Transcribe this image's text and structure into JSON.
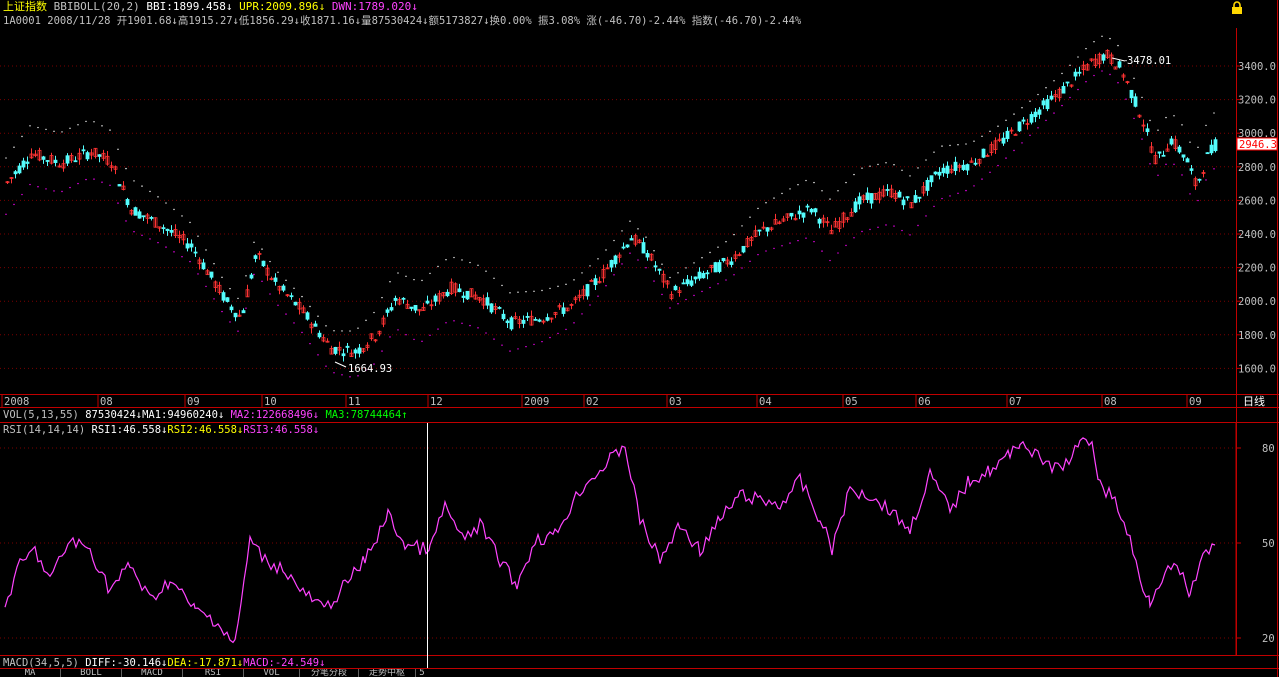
{
  "header": {
    "index_name": "上证指数",
    "indicator": "BBIBOLL(20,2)",
    "bbi": "BBI:1899.458",
    "upr": "UPR:2009.896",
    "dwn": "DWN:1789.020",
    "arrow": "↓",
    "arrow_up": "↑",
    "ohlc_line": "1A0001 2008/11/28 开1901.68↓高1915.27↓低1856.29↓收1871.16↓量87530424↓额5173827↓换0.00% 振3.08% 涨(-46.70)-2.44% 指数(-46.70)-2.44%"
  },
  "price_panel": {
    "y_labels": [
      "3400.0",
      "3200.0",
      "3000.0",
      "2800.0",
      "2600.0",
      "2400.0",
      "2200.0",
      "2000.0",
      "1800.0",
      "1600.0"
    ],
    "last_price_badge": "2946.3",
    "high_annotation": "3478.01",
    "low_annotation": "1664.93",
    "x_labels": [
      "2008",
      "08",
      "09",
      "10",
      "11",
      "12",
      "2009",
      "02",
      "03",
      "04",
      "05",
      "06",
      "07",
      "08",
      "09"
    ],
    "period_label": "日线",
    "colors": {
      "up": "#ff3333",
      "down": "#54fcfc",
      "upper_band": "#ffffff",
      "lower_band": "#ff00ff",
      "grid": "#800000",
      "axis": "#ff0000"
    }
  },
  "vol_header": {
    "label": "VOL(5,13,55)",
    "value": "87530424",
    "ma1": "MA1:94960240",
    "ma2": "MA2:122668496",
    "ma3": "MA3:78744464"
  },
  "rsi_panel": {
    "label": "RSI(14,14,14)",
    "rsi1": "RSI1:46.558",
    "rsi2": "RSI2:46.558",
    "rsi3": "RSI3:46.558",
    "y_labels": [
      "80",
      "50",
      "20"
    ]
  },
  "macd_header": {
    "label": "MACD(34,5,5)",
    "diff": "DIFF:-30.146",
    "dea": "DEA:-17.871",
    "macd": "MACD:-24.549"
  },
  "bottom_tabs": [
    "MA",
    "BOLL",
    "MACD",
    "RSI",
    "VOL",
    "分笔分段",
    "走势中枢",
    "5"
  ],
  "toolbar": {
    "icon": "lock-icon"
  }
}
